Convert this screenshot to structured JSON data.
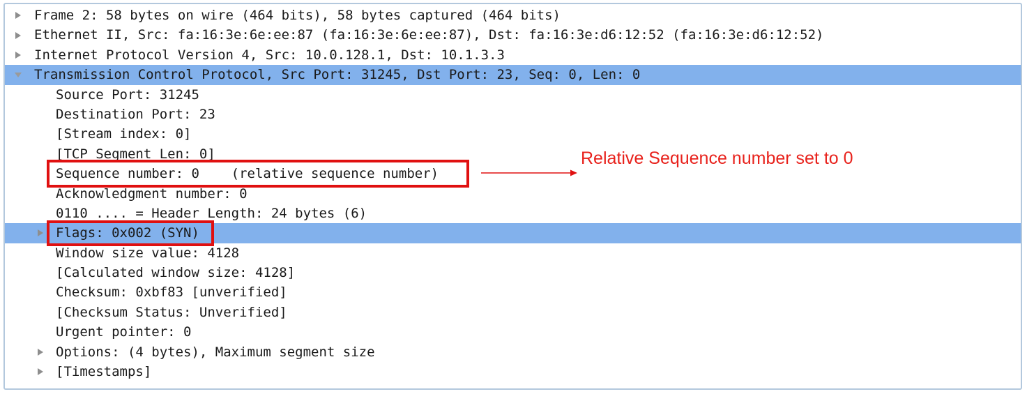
{
  "packet_details": {
    "rows": [
      {
        "id": "frame",
        "level": 0,
        "toggle": "collapsed",
        "selected": false,
        "text": "Frame 2: 58 bytes on wire (464 bits), 58 bytes captured (464 bits)"
      },
      {
        "id": "ethernet",
        "level": 0,
        "toggle": "collapsed",
        "selected": false,
        "text": "Ethernet II, Src: fa:16:3e:6e:ee:87 (fa:16:3e:6e:ee:87), Dst: fa:16:3e:d6:12:52 (fa:16:3e:d6:12:52)"
      },
      {
        "id": "ipv4",
        "level": 0,
        "toggle": "collapsed",
        "selected": false,
        "text": "Internet Protocol Version 4, Src: 10.0.128.1, Dst: 10.1.3.3"
      },
      {
        "id": "tcp",
        "level": 0,
        "toggle": "expanded",
        "selected": true,
        "text": "Transmission Control Protocol, Src Port: 31245, Dst Port: 23, Seq: 0, Len: 0"
      },
      {
        "id": "src-port",
        "level": 1,
        "toggle": "none",
        "selected": false,
        "text": "Source Port: 31245"
      },
      {
        "id": "dst-port",
        "level": 1,
        "toggle": "none",
        "selected": false,
        "text": "Destination Port: 23"
      },
      {
        "id": "stream-index",
        "level": 1,
        "toggle": "none",
        "selected": false,
        "text": "[Stream index: 0]"
      },
      {
        "id": "segment-len",
        "level": 1,
        "toggle": "none",
        "selected": false,
        "text": "[TCP Segment Len: 0]"
      },
      {
        "id": "seq-number",
        "level": 1,
        "toggle": "none",
        "selected": false,
        "text": "Sequence number: 0    (relative sequence number)"
      },
      {
        "id": "ack-number",
        "level": 1,
        "toggle": "none",
        "selected": false,
        "text": "Acknowledgment number: 0"
      },
      {
        "id": "header-length",
        "level": 1,
        "toggle": "none",
        "selected": false,
        "text": "0110 .... = Header Length: 24 bytes (6)"
      },
      {
        "id": "flags",
        "level": 1,
        "toggle": "collapsed",
        "selected": true,
        "text": "Flags: 0x002 (SYN)"
      },
      {
        "id": "window-size",
        "level": 1,
        "toggle": "none",
        "selected": false,
        "text": "Window size value: 4128"
      },
      {
        "id": "calc-window",
        "level": 1,
        "toggle": "none",
        "selected": false,
        "text": "[Calculated window size: 4128]"
      },
      {
        "id": "checksum",
        "level": 1,
        "toggle": "none",
        "selected": false,
        "text": "Checksum: 0xbf83 [unverified]"
      },
      {
        "id": "checksum-status",
        "level": 1,
        "toggle": "none",
        "selected": false,
        "text": "[Checksum Status: Unverified]"
      },
      {
        "id": "urgent-pointer",
        "level": 1,
        "toggle": "none",
        "selected": false,
        "text": "Urgent pointer: 0"
      },
      {
        "id": "options",
        "level": 1,
        "toggle": "collapsed",
        "selected": false,
        "text": "Options: (4 bytes), Maximum segment size"
      },
      {
        "id": "timestamps",
        "level": 1,
        "toggle": "collapsed",
        "selected": false,
        "text": "[Timestamps]"
      }
    ]
  },
  "annotation": {
    "text": "Relative Sequence number set to 0"
  },
  "colors": {
    "selection": "#82b1ec",
    "highlight": "#e01010",
    "annotation": "#e8221c",
    "panel_border": "#b3c8dd"
  }
}
